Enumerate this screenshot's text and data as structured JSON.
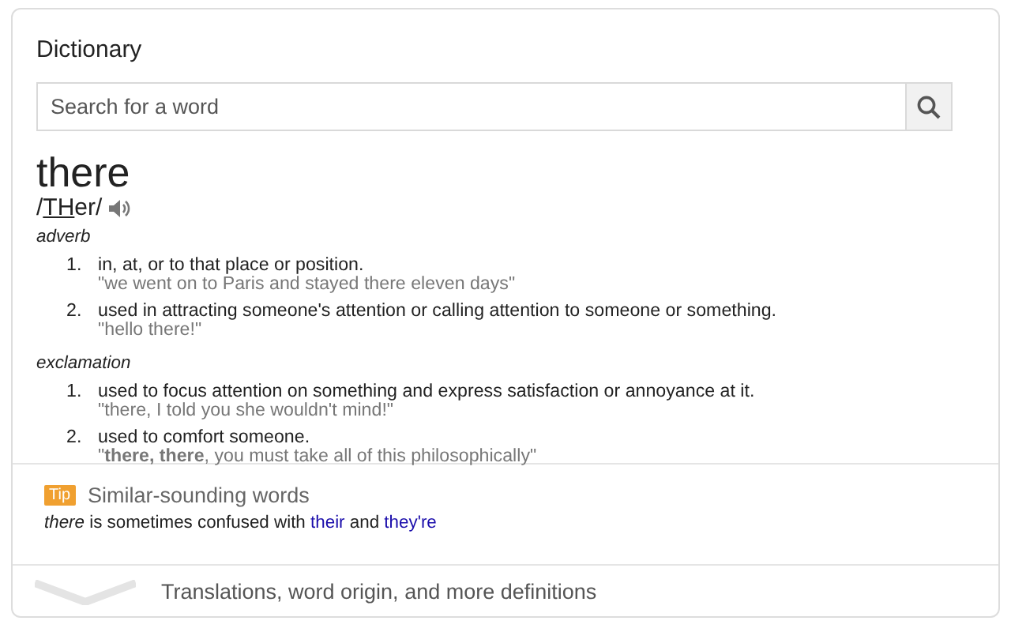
{
  "title": "Dictionary",
  "search": {
    "placeholder": "Search for a word"
  },
  "word": "there",
  "phonetic": [
    {
      "text": "/",
      "kind": "plain"
    },
    {
      "text": "TH",
      "kind": "underlined"
    },
    {
      "text": "er/",
      "kind": "plain"
    }
  ],
  "groups": [
    {
      "part_of_speech": "adverb",
      "senses": [
        {
          "number": "1.",
          "definition": "in, at, or to that place or position.",
          "example": "\"we went on to Paris and stayed there eleven days\""
        },
        {
          "number": "2.",
          "definition": "used in attracting someone's attention or calling attention to someone or something.",
          "example": "\"hello there!\""
        }
      ]
    },
    {
      "part_of_speech": "exclamation",
      "senses": [
        {
          "number": "1.",
          "definition": "used to focus attention on something and express satisfaction or annoyance at it.",
          "example": "\"there, I told you she wouldn't mind!\""
        },
        {
          "number": "2.",
          "definition": "used to comfort someone.",
          "example": "\"**there, there**, you must take all of this philosophically\""
        }
      ]
    }
  ],
  "tip": {
    "badge": "Tip",
    "heading": "Similar-sounding words",
    "sentence": [
      {
        "text": "there",
        "kind": "italic"
      },
      {
        "text": " is sometimes confused with ",
        "kind": "plain"
      },
      {
        "text": "their",
        "kind": "link"
      },
      {
        "text": " and ",
        "kind": "plain"
      },
      {
        "text": "they're",
        "kind": "link"
      }
    ]
  },
  "more": "Translations, word origin, and more definitions"
}
